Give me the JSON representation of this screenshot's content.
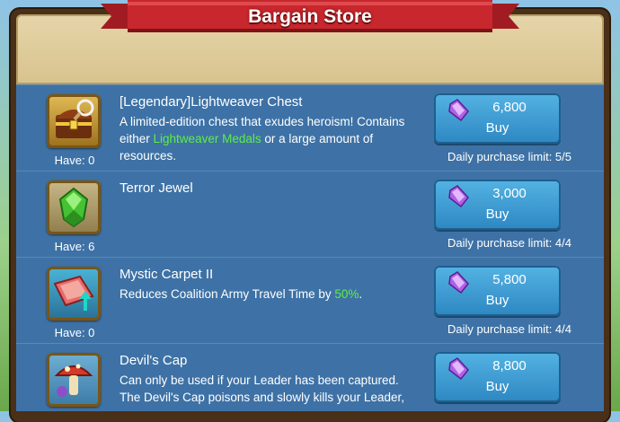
{
  "window": {
    "title": "Bargain Store"
  },
  "colors": {
    "accent_green": "#5dee43",
    "banner_red": "#c8272d",
    "button_blue": "#3a96cf"
  },
  "items": [
    {
      "name": "[Legendary]Lightweaver Chest",
      "desc_before": "A limited-edition chest that exudes heroism! Contains either ",
      "desc_highlight": "Lightweaver Medals",
      "desc_after": " or a large amount of resources.",
      "have": "Have: 0",
      "price": "6,800",
      "buy_label": "Buy",
      "limit": "Daily purchase limit: 5/5",
      "icon": "treasure-chest-icon"
    },
    {
      "name": "Terror Jewel",
      "desc_before": "",
      "desc_highlight": "",
      "desc_after": "",
      "have": "Have: 6",
      "price": "3,000",
      "buy_label": "Buy",
      "limit": "Daily purchase limit: 4/4",
      "icon": "green-jewel-icon"
    },
    {
      "name": "Mystic Carpet II",
      "desc_before": "Reduces Coalition Army Travel Time by ",
      "desc_highlight": "50%",
      "desc_after": ".",
      "have": "Have: 0",
      "price": "5,800",
      "buy_label": "Buy",
      "limit": "Daily purchase limit: 4/4",
      "icon": "flying-carpet-icon"
    },
    {
      "name": "Devil's Cap",
      "desc_before": "Can only be used if your Leader has been captured. The Devil's Cap poisons and slowly kills your Leader,",
      "desc_highlight": "",
      "desc_after": "",
      "have": "",
      "price": "8,800",
      "buy_label": "Buy",
      "limit": "",
      "icon": "mushroom-icon"
    }
  ]
}
